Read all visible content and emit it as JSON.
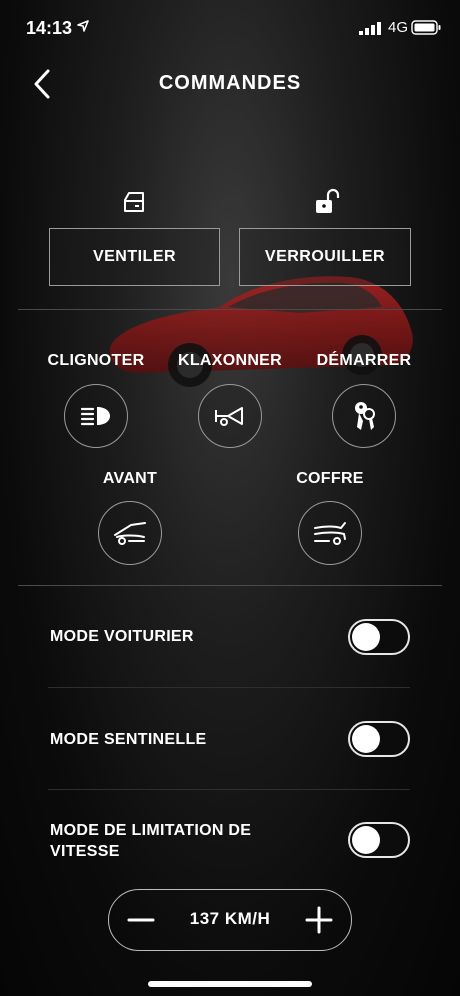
{
  "status_bar": {
    "time": "14:13",
    "network": "4G"
  },
  "header": {
    "title": "COMMANDES",
    "back_icon": "chevron-left-icon"
  },
  "quick_actions": [
    {
      "label": "VENTILER",
      "icon": "window-icon"
    },
    {
      "label": "VERROUILLER",
      "icon": "unlock-icon"
    }
  ],
  "controls": [
    {
      "label": "CLIGNOTER",
      "icon": "headlight-icon"
    },
    {
      "label": "KLAXONNER",
      "icon": "horn-icon"
    },
    {
      "label": "DÉMARRER",
      "icon": "keys-icon"
    },
    {
      "label": "AVANT",
      "icon": "frunk-icon"
    },
    {
      "label": "COFFRE",
      "icon": "trunk-icon"
    }
  ],
  "settings": [
    {
      "label": "MODE VOITURIER",
      "enabled": false
    },
    {
      "label": "MODE SENTINELLE",
      "enabled": false
    },
    {
      "label": "MODE DE LIMITATION DE VITESSE",
      "enabled": false
    }
  ],
  "speed_limit": {
    "value": "137 KM/H"
  },
  "colors": {
    "background": "#0b0b0b",
    "car": "#8e1a1a",
    "border": "#9a9a9a",
    "text": "#ffffff"
  }
}
